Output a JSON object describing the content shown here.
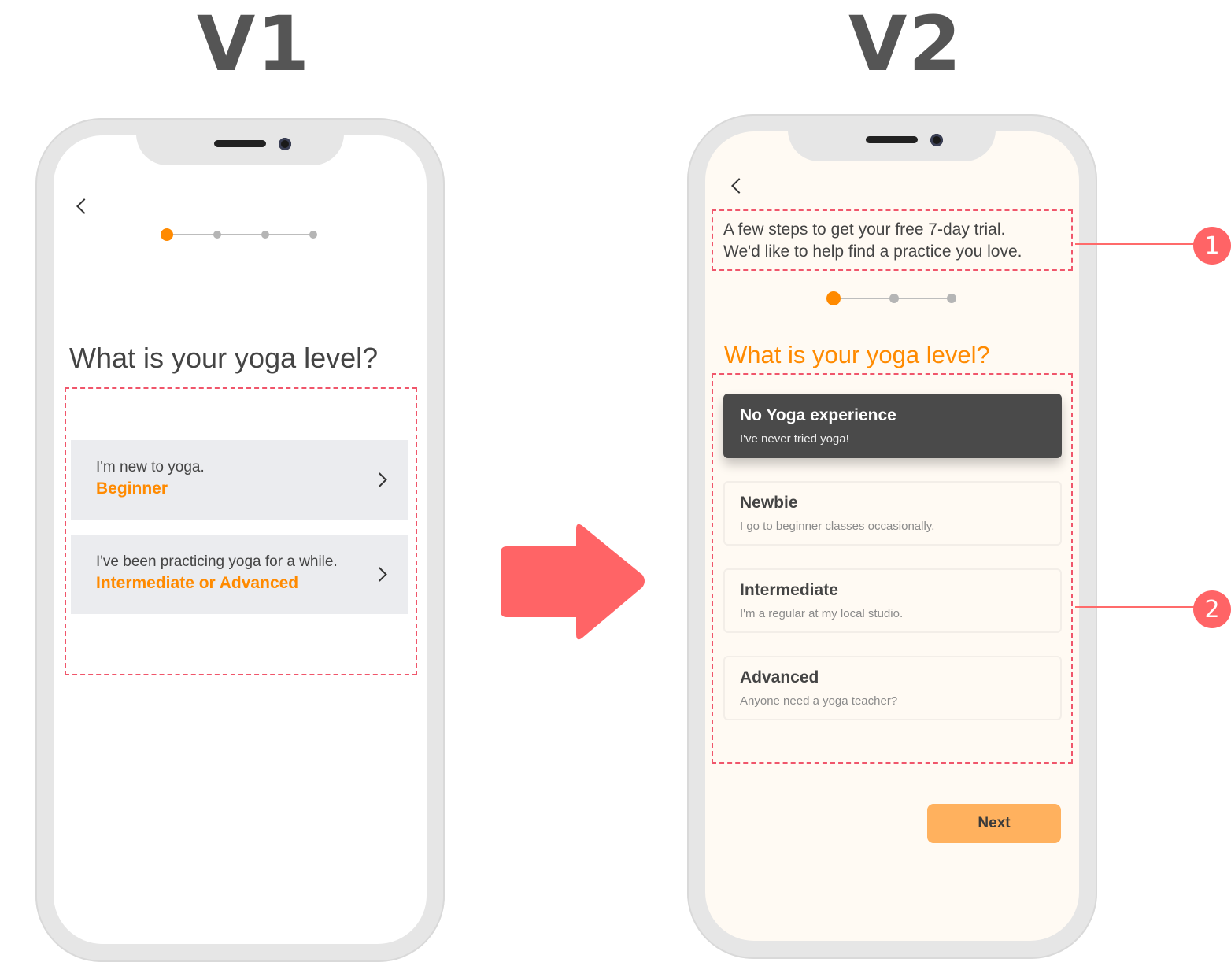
{
  "titles": {
    "v1": "V1",
    "v2": "V2"
  },
  "v1": {
    "question": "What is your yoga level?",
    "options": [
      {
        "line1": "I'm new to yoga.",
        "line2": "Beginner"
      },
      {
        "line1": "I've been practicing yoga for a while.",
        "line2": "Intermediate or Advanced"
      }
    ],
    "stepper": {
      "total": 4,
      "current": 1
    }
  },
  "v2": {
    "intro_line1": "A few steps to get your free 7-day trial.",
    "intro_line2": "We'd like to help find a practice you love.",
    "question": "What is your yoga level?",
    "stepper": {
      "total": 3,
      "current": 1
    },
    "options": [
      {
        "title": "No Yoga experience",
        "subtitle": "I've never tried yoga!",
        "selected": true
      },
      {
        "title": "Newbie",
        "subtitle": "I go to beginner classes occasionally.",
        "selected": false
      },
      {
        "title": "Intermediate",
        "subtitle": "I'm a regular at my local studio.",
        "selected": false
      },
      {
        "title": "Advanced",
        "subtitle": "Anyone need a yoga teacher?",
        "selected": false
      }
    ],
    "next_label": "Next"
  },
  "callouts": [
    "1",
    "2"
  ],
  "icons": {
    "back": "chevron-left-icon",
    "option": "chevron-right-icon",
    "transition": "arrow-right-icon"
  },
  "colors": {
    "accent": "#ff8a00",
    "arrow": "#ff6466",
    "annotation": "#f0566b",
    "next_button": "#ffb15e",
    "selected_card": "#4a4a4a",
    "v2_background": "#fffaf3"
  }
}
